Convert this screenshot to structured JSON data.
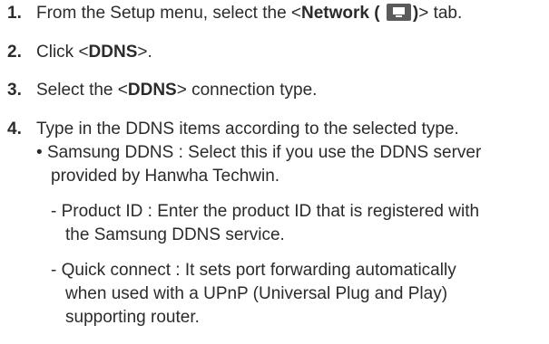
{
  "steps": [
    {
      "number": "1.",
      "pre": "From the Setup menu, select the <",
      "bold": "Network (",
      "bold_close": ")",
      "post": "> tab.",
      "icon": "network-monitor-icon"
    },
    {
      "number": "2.",
      "pre": "Click <",
      "bold": "DDNS",
      "post": ">."
    },
    {
      "number": "3.",
      "pre": "Select the <",
      "bold": "DDNS",
      "post": "> connection type."
    },
    {
      "number": "4.",
      "text": "Type in the DDNS items according to the selected type."
    }
  ],
  "bullet": {
    "marker": "•",
    "line1": "Samsung DDNS : Select this if you use the DDNS server",
    "line2": "provided by Hanwha Techwin."
  },
  "dashes": [
    {
      "marker": "-",
      "line1": "Product ID : Enter the product ID that is registered with",
      "line2": "the Samsung DDNS service."
    },
    {
      "marker": "-",
      "line1": "Quick connect : It sets port forwarding automatically",
      "line2": "when used with a UPnP (Universal Plug and Play)",
      "line3": "supporting router."
    }
  ]
}
